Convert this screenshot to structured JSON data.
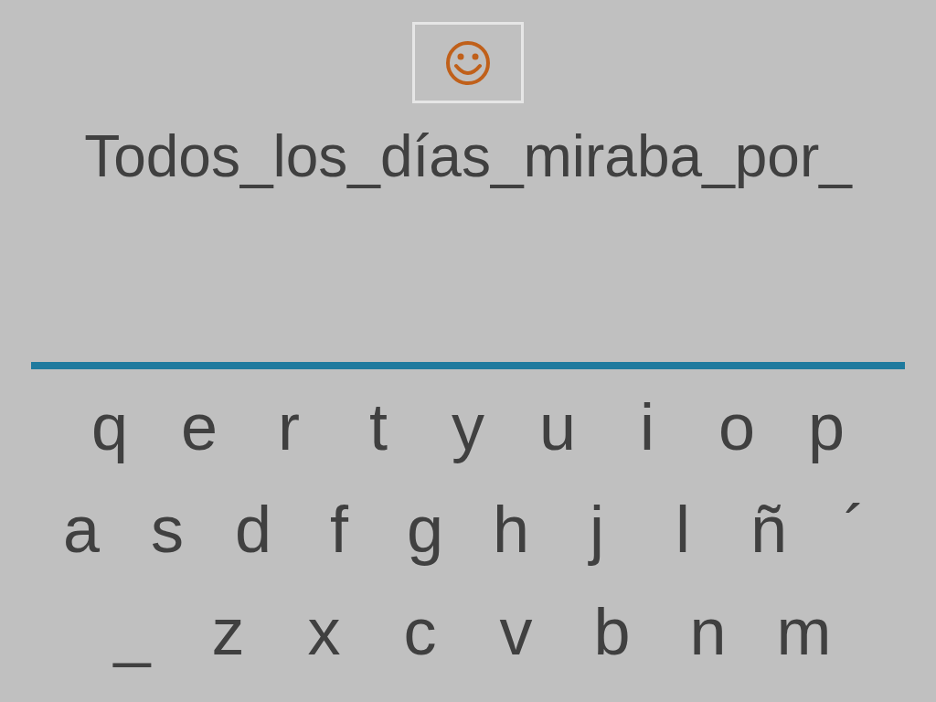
{
  "sentence": "Todos_los_días_miraba_por_",
  "keyboard": {
    "rows": [
      [
        "q",
        "e",
        "r",
        "t",
        "y",
        "u",
        "i",
        "o",
        "p"
      ],
      [
        "a",
        "s",
        "d",
        "f",
        "g",
        "h",
        "j",
        "l",
        "ñ",
        "´"
      ],
      [
        "_",
        "z",
        "x",
        "c",
        "v",
        "b",
        "n",
        "m"
      ]
    ]
  }
}
